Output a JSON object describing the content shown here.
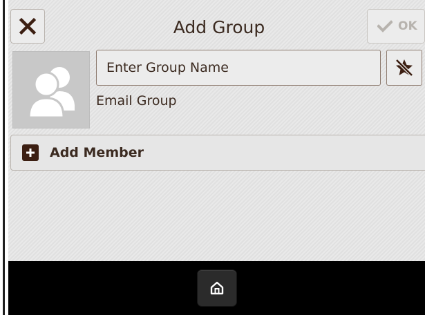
{
  "header": {
    "title": "Add Group",
    "close_icon": "close-icon",
    "ok_label": "OK",
    "ok_icon": "checkmark-icon"
  },
  "group": {
    "avatar_icon": "group-avatar-icon",
    "name_placeholder": "Enter Group Name",
    "name_value": "",
    "favorite_icon": "favorite-star-icon",
    "type_label": "Email Group"
  },
  "members": {
    "add_label": "Add Member",
    "add_icon": "plus-icon"
  },
  "bottom_bar": {
    "home_icon": "home-icon"
  },
  "colors": {
    "accent": "#3c1f12",
    "text": "#3b2a20",
    "disabled": "#b7b3ae",
    "background": "#e4e4e4",
    "bottom_bar": "#000000"
  }
}
